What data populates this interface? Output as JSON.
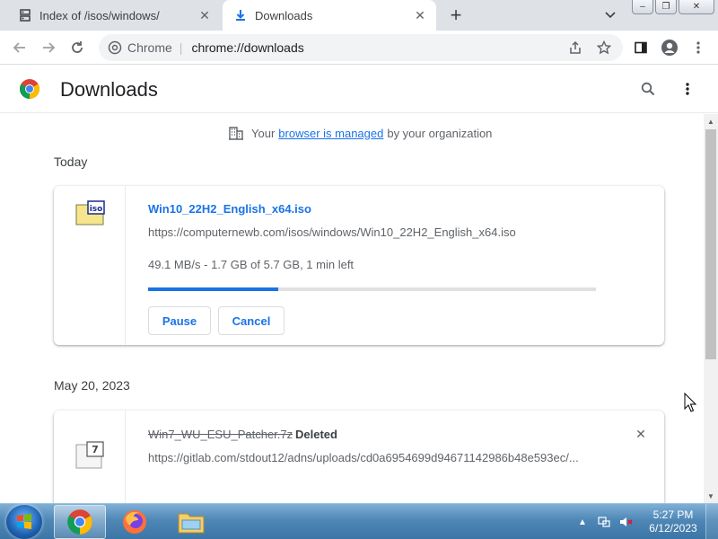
{
  "tabs": [
    {
      "title": "Index of /isos/windows/",
      "favicon": "server-icon",
      "active": false
    },
    {
      "title": "Downloads",
      "favicon": "download-icon",
      "active": true
    }
  ],
  "toolbar": {
    "omnibox_chip": "Chrome",
    "omnibox_sep": "|",
    "omnibox_url": "chrome://downloads"
  },
  "page": {
    "title": "Downloads"
  },
  "managed": {
    "prefix": "Your",
    "link": "browser is managed",
    "suffix": "by your organization"
  },
  "sections": [
    {
      "label": "Today",
      "download": {
        "filename": "Win10_22H2_English_x64.iso",
        "url": "https://computernewb.com/isos/windows/Win10_22H2_English_x64.iso",
        "status": "49.1 MB/s - 1.7 GB of 5.7 GB, 1 min left",
        "progress_percent": 29,
        "file_icon_label": "iso",
        "pause_label": "Pause",
        "cancel_label": "Cancel"
      }
    },
    {
      "label": "May 20, 2023",
      "download": {
        "filename": "Win7_WU_ESU_Patcher.7z",
        "state": "Deleted",
        "url": "https://gitlab.com/stdout12/adns/uploads/cd0a6954699d94671142986b48e593ec/...",
        "file_icon_label": "7"
      }
    }
  ],
  "taskbar": {
    "time": "5:27 PM",
    "date": "6/12/2023"
  },
  "colors": {
    "accent": "#1a73e8",
    "tabstrip": "#dee1e6"
  }
}
